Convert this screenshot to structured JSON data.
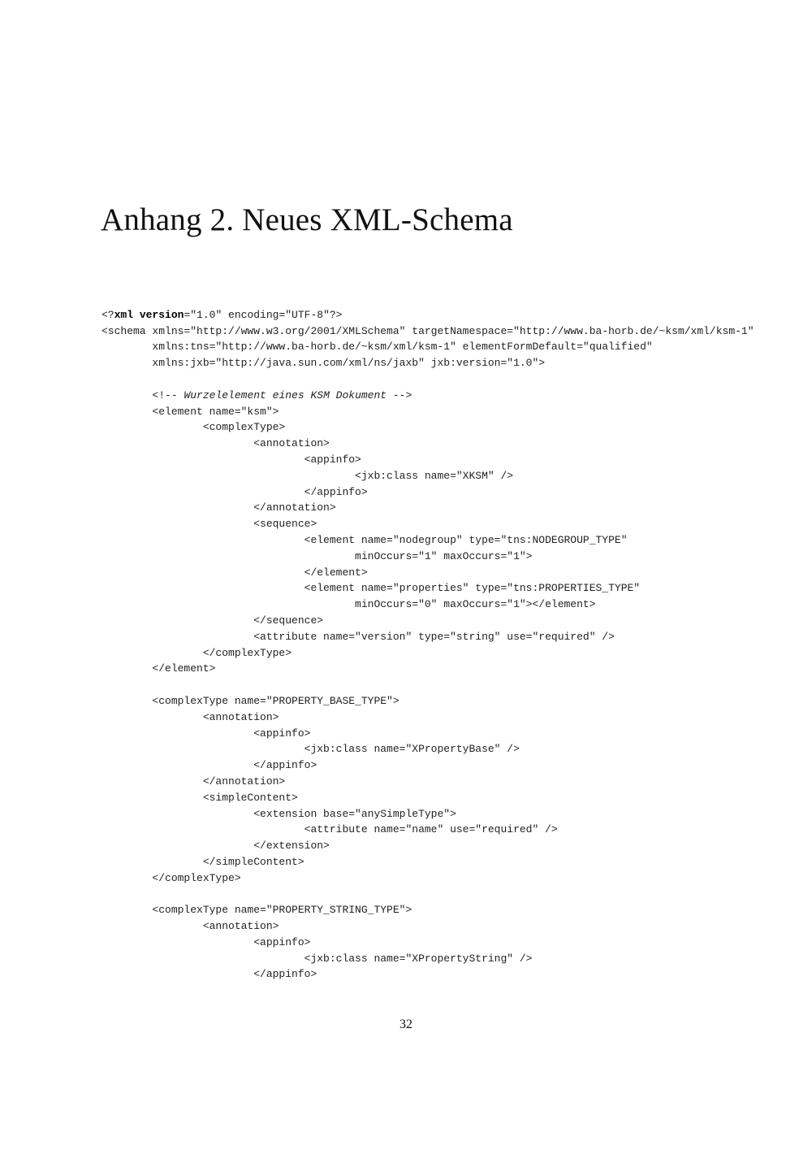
{
  "heading": "Anhang 2.  Neues XML-Schema",
  "code": {
    "xml_decl": {
      "open": "<?",
      "keyword_xml": "xml",
      "keyword_version": "version",
      "rest": "=\"1.0\" encoding=\"UTF-8\"?>"
    },
    "comment": {
      "open": "<!-- ",
      "text": "Wurzelelement eines KSM Dokument",
      "close": " -->"
    },
    "lines": [
      "<schema xmlns=\"http://www.w3.org/2001/XMLSchema\" targetNamespace=\"http://www.ba-horb.de/~ksm/xml/ksm-1\"",
      "        xmlns:tns=\"http://www.ba-horb.de/~ksm/xml/ksm-1\" elementFormDefault=\"qualified\"",
      "        xmlns:jxb=\"http://java.sun.com/xml/ns/jaxb\" jxb:version=\"1.0\">",
      "",
      "        <element name=\"ksm\">",
      "                <complexType>",
      "                        <annotation>",
      "                                <appinfo>",
      "                                        <jxb:class name=\"XKSM\" />",
      "                                </appinfo>",
      "                        </annotation>",
      "                        <sequence>",
      "                                <element name=\"nodegroup\" type=\"tns:NODEGROUP_TYPE\"",
      "                                        minOccurs=\"1\" maxOccurs=\"1\">",
      "                                </element>",
      "                                <element name=\"properties\" type=\"tns:PROPERTIES_TYPE\"",
      "                                        minOccurs=\"0\" maxOccurs=\"1\"></element>",
      "                        </sequence>",
      "                        <attribute name=\"version\" type=\"string\" use=\"required\" />",
      "                </complexType>",
      "        </element>",
      "",
      "        <complexType name=\"PROPERTY_BASE_TYPE\">",
      "                <annotation>",
      "                        <appinfo>",
      "                                <jxb:class name=\"XPropertyBase\" />",
      "                        </appinfo>",
      "                </annotation>",
      "                <simpleContent>",
      "                        <extension base=\"anySimpleType\">",
      "                                <attribute name=\"name\" use=\"required\" />",
      "                        </extension>",
      "                </simpleContent>",
      "        </complexType>",
      "",
      "        <complexType name=\"PROPERTY_STRING_TYPE\">",
      "                <annotation>",
      "                        <appinfo>",
      "                                <jxb:class name=\"XPropertyString\" />",
      "                        </appinfo>"
    ]
  },
  "page_number": "32"
}
